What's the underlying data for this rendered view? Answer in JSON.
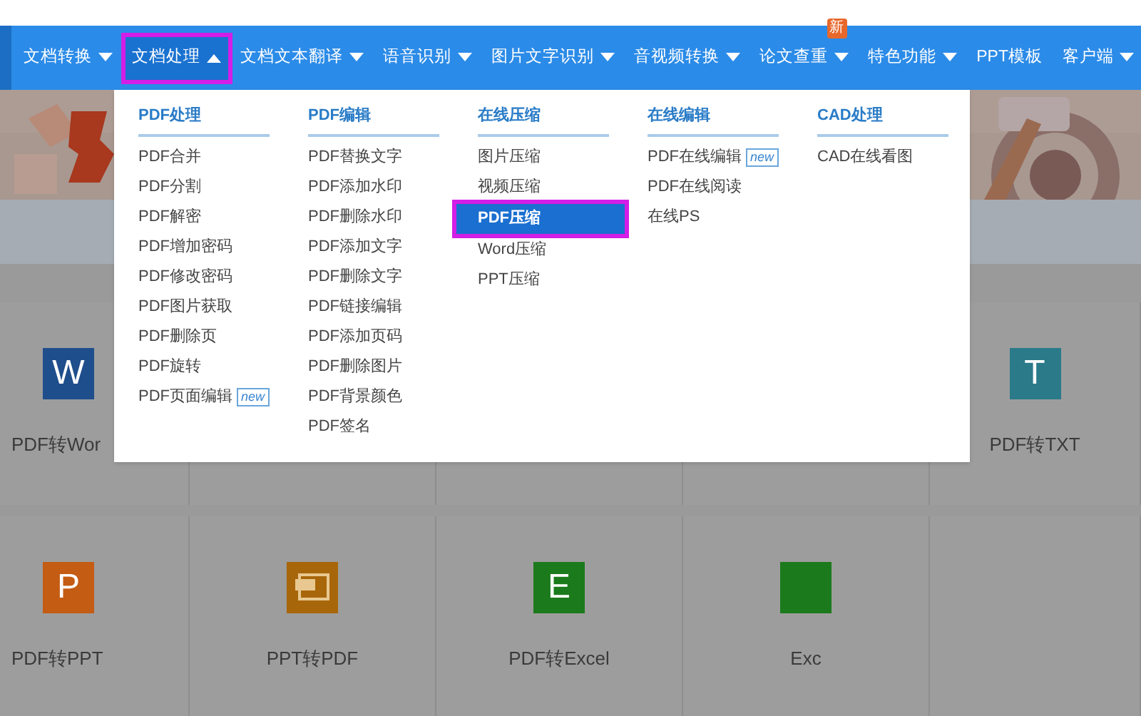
{
  "nav": {
    "items": [
      {
        "label": "文档转换",
        "caret": true,
        "selected": false,
        "highlighted": false
      },
      {
        "label": "文档处理",
        "caret": true,
        "selected": true,
        "highlighted": true
      },
      {
        "label": "文档文本翻译",
        "caret": true,
        "selected": false,
        "highlighted": false
      },
      {
        "label": "语音识别",
        "caret": true,
        "selected": false,
        "highlighted": false
      },
      {
        "label": "图片文字识别",
        "caret": true,
        "selected": false,
        "highlighted": false
      },
      {
        "label": "音视频转换",
        "caret": true,
        "selected": false,
        "highlighted": false
      },
      {
        "label": "论文查重",
        "caret": true,
        "selected": false,
        "highlighted": false,
        "badge": "新"
      },
      {
        "label": "特色功能",
        "caret": true,
        "selected": false,
        "highlighted": false
      },
      {
        "label": "PPT模板",
        "caret": false,
        "selected": false,
        "highlighted": false
      },
      {
        "label": "客户端",
        "caret": true,
        "selected": false,
        "highlighted": false
      }
    ]
  },
  "dropdown": {
    "columns": [
      {
        "heading": "PDF处理",
        "items": [
          {
            "label": "PDF合并",
            "selected": false,
            "highlighted": false
          },
          {
            "label": "PDF分割",
            "selected": false,
            "highlighted": false
          },
          {
            "label": "PDF解密",
            "selected": false,
            "highlighted": false
          },
          {
            "label": "PDF增加密码",
            "selected": false,
            "highlighted": false
          },
          {
            "label": "PDF修改密码",
            "selected": false,
            "highlighted": false
          },
          {
            "label": "PDF图片获取",
            "selected": false,
            "highlighted": false
          },
          {
            "label": "PDF删除页",
            "selected": false,
            "highlighted": false
          },
          {
            "label": "PDF旋转",
            "selected": false,
            "highlighted": false
          },
          {
            "label": "PDF页面编辑",
            "selected": false,
            "highlighted": false,
            "tag": "new"
          }
        ]
      },
      {
        "heading": "PDF编辑",
        "items": [
          {
            "label": "PDF替换文字",
            "selected": false,
            "highlighted": false
          },
          {
            "label": "PDF添加水印",
            "selected": false,
            "highlighted": false
          },
          {
            "label": "PDF删除水印",
            "selected": false,
            "highlighted": false
          },
          {
            "label": "PDF添加文字",
            "selected": false,
            "highlighted": false
          },
          {
            "label": "PDF删除文字",
            "selected": false,
            "highlighted": false
          },
          {
            "label": "PDF链接编辑",
            "selected": false,
            "highlighted": false
          },
          {
            "label": "PDF添加页码",
            "selected": false,
            "highlighted": false
          },
          {
            "label": "PDF删除图片",
            "selected": false,
            "highlighted": false
          },
          {
            "label": "PDF背景颜色",
            "selected": false,
            "highlighted": false
          },
          {
            "label": "PDF签名",
            "selected": false,
            "highlighted": false
          }
        ]
      },
      {
        "heading": "在线压缩",
        "items": [
          {
            "label": "图片压缩",
            "selected": false,
            "highlighted": false
          },
          {
            "label": "视频压缩",
            "selected": false,
            "highlighted": false
          },
          {
            "label": "PDF压缩",
            "selected": true,
            "highlighted": true
          },
          {
            "label": "Word压缩",
            "selected": false,
            "highlighted": false
          },
          {
            "label": "PPT压缩",
            "selected": false,
            "highlighted": false
          }
        ]
      },
      {
        "heading": "在线编辑",
        "items": [
          {
            "label": "PDF在线编辑",
            "selected": false,
            "highlighted": false,
            "tag": "new"
          },
          {
            "label": "PDF在线阅读",
            "selected": false,
            "highlighted": false
          },
          {
            "label": "在线PS",
            "selected": false,
            "highlighted": false
          }
        ]
      },
      {
        "heading": "CAD处理",
        "items": [
          {
            "label": "CAD在线看图",
            "selected": false,
            "highlighted": false
          }
        ]
      }
    ]
  },
  "cards": {
    "rows": [
      [
        {
          "kind": "letter",
          "icon_letter": "W",
          "label": "PDF转Wor",
          "color": "#1f4e8c"
        },
        {
          "kind": "hidden"
        },
        {
          "kind": "hidden"
        },
        {
          "kind": "hidden"
        },
        {
          "kind": "letter",
          "icon_letter": "T",
          "label": "PDF转TXT",
          "color": "#2a7a8a"
        }
      ],
      [
        {
          "kind": "letter",
          "icon_letter": "P",
          "label": "PDF转PPT",
          "color": "#c45c14"
        },
        {
          "kind": "document",
          "label": "PPT转PDF",
          "color": "#a8660a"
        },
        {
          "kind": "letter",
          "icon_letter": "E",
          "label": "PDF转Excel",
          "color": "#1b7a1b"
        },
        {
          "kind": "blank",
          "label": "Exc",
          "color": "#1b7a1b"
        }
      ]
    ]
  }
}
